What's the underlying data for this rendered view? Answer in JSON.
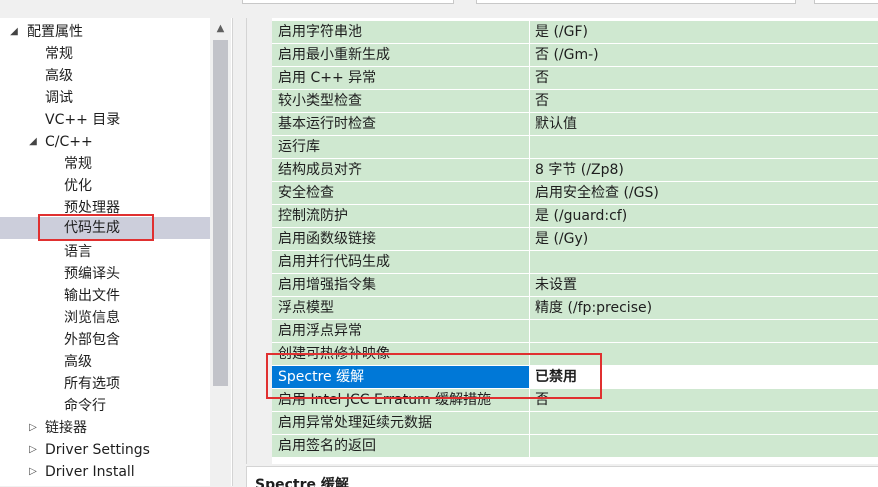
{
  "tree": {
    "items": [
      {
        "label": "配置属性",
        "arrow": "◢"
      },
      {
        "label": "常规",
        "arrow": ""
      },
      {
        "label": "高级",
        "arrow": ""
      },
      {
        "label": "调试",
        "arrow": ""
      },
      {
        "label": "VC++ 目录",
        "arrow": ""
      },
      {
        "label": "C/C++",
        "arrow": "◢"
      },
      {
        "label": "常规",
        "arrow": ""
      },
      {
        "label": "优化",
        "arrow": ""
      },
      {
        "label": "预处理器",
        "arrow": ""
      },
      {
        "label": "代码生成",
        "arrow": ""
      },
      {
        "label": "语言",
        "arrow": ""
      },
      {
        "label": "预编译头",
        "arrow": ""
      },
      {
        "label": "输出文件",
        "arrow": ""
      },
      {
        "label": "浏览信息",
        "arrow": ""
      },
      {
        "label": "外部包含",
        "arrow": ""
      },
      {
        "label": "高级",
        "arrow": ""
      },
      {
        "label": "所有选项",
        "arrow": ""
      },
      {
        "label": "命令行",
        "arrow": ""
      },
      {
        "label": "链接器",
        "arrow": "▷"
      },
      {
        "label": "Driver Settings",
        "arrow": "▷"
      },
      {
        "label": "Driver Install",
        "arrow": "▷"
      }
    ],
    "scroll_up_icon": "▲"
  },
  "properties": [
    {
      "name": "启用字符串池",
      "value": "是 (/GF)"
    },
    {
      "name": "启用最小重新生成",
      "value": "否 (/Gm-)"
    },
    {
      "name": "启用 C++ 异常",
      "value": "否"
    },
    {
      "name": "较小类型检查",
      "value": "否"
    },
    {
      "name": "基本运行时检查",
      "value": "默认值"
    },
    {
      "name": "运行库",
      "value": ""
    },
    {
      "name": "结构成员对齐",
      "value": "8 字节 (/Zp8)"
    },
    {
      "name": "安全检查",
      "value": "启用安全检查 (/GS)"
    },
    {
      "name": "控制流防护",
      "value": "是 (/guard:cf)"
    },
    {
      "name": "启用函数级链接",
      "value": "是 (/Gy)"
    },
    {
      "name": "启用并行代码生成",
      "value": ""
    },
    {
      "name": "启用增强指令集",
      "value": "未设置"
    },
    {
      "name": "浮点模型",
      "value": "精度 (/fp:precise)"
    },
    {
      "name": "启用浮点异常",
      "value": ""
    },
    {
      "name": "创建可热修补映像",
      "value": ""
    },
    {
      "name": "Spectre 缓解",
      "value": "已禁用"
    },
    {
      "name": "启用 Intel JCC Erratum 缓解措施",
      "value": "否"
    },
    {
      "name": "启用异常处理延续元数据",
      "value": ""
    },
    {
      "name": "启用签名的返回",
      "value": ""
    }
  ],
  "description": {
    "title": "Spectre 缓解"
  },
  "colors": {
    "row_bg": "#cfe8d0",
    "selection": "#0078d7",
    "highlight": "#e03030"
  }
}
